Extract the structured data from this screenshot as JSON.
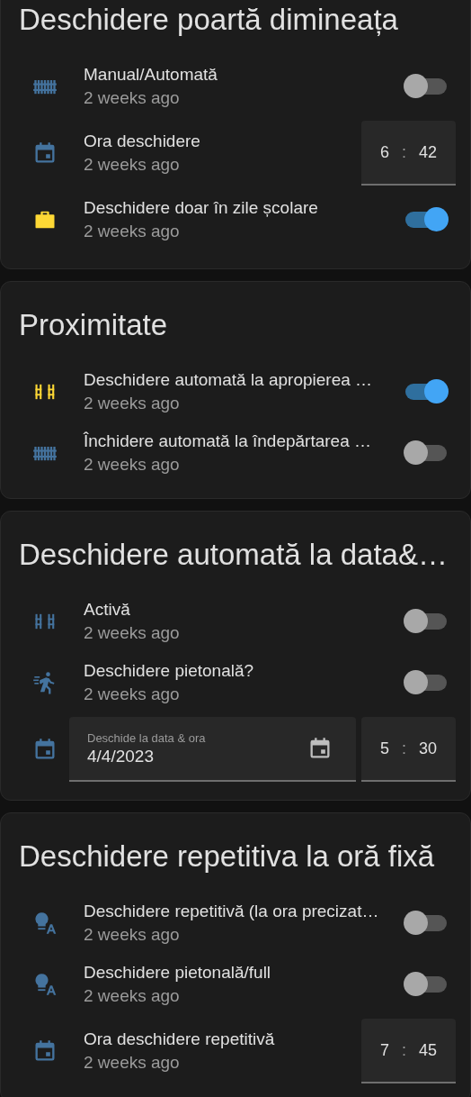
{
  "cards": [
    {
      "title": "Deschidere poartă dimineața",
      "rows": [
        {
          "kind": "toggle",
          "icon": {
            "kind": "fence"
          },
          "name": "Manual/Automată",
          "secondary": "2 weeks ago",
          "on": false
        },
        {
          "kind": "time",
          "icon": {
            "kind": "calendar"
          },
          "name": "Ora deschidere",
          "secondary": "2 weeks ago",
          "hour": "6",
          "separator": ":",
          "minute": "42"
        },
        {
          "kind": "toggle",
          "icon": {
            "kind": "briefcase"
          },
          "name": "Deschidere doar în zile școlare",
          "secondary": "2 weeks ago",
          "on": true
        }
      ]
    },
    {
      "title": "Proximitate",
      "rows": [
        {
          "kind": "toggle",
          "icon": {
            "kind": "gate"
          },
          "name": "Deschidere automată la apropierea …",
          "secondary": "2 weeks ago",
          "on": true
        },
        {
          "kind": "toggle",
          "icon": {
            "kind": "fence"
          },
          "name": "Închidere automată la îndepărtarea …",
          "secondary": "2 weeks ago",
          "on": false
        }
      ]
    },
    {
      "title": "Deschidere automată la data&…",
      "rows": [
        {
          "kind": "toggle",
          "icon": {
            "kind": "gate"
          },
          "name": "Activă",
          "secondary": "2 weeks ago",
          "on": false
        },
        {
          "kind": "toggle",
          "icon": {
            "kind": "walk"
          },
          "name": "Deschidere pietonală?",
          "secondary": "2 weeks ago",
          "on": false
        },
        {
          "kind": "datetime",
          "icon": {
            "kind": "calendar"
          },
          "label": "Deschide la data & ora",
          "date": "4/4/2023",
          "hour": "5",
          "separator": ":",
          "minute": "30"
        }
      ]
    },
    {
      "title": "Deschidere repetitiva la oră fixă",
      "rows": [
        {
          "kind": "toggle",
          "icon": {
            "kind": "bulb"
          },
          "name": "Deschidere repetitivă (la ora precizat…",
          "secondary": "2 weeks ago",
          "on": false
        },
        {
          "kind": "toggle",
          "icon": {
            "kind": "bulb"
          },
          "name": "Deschidere pietonală/full",
          "secondary": "2 weeks ago",
          "on": false
        },
        {
          "kind": "time",
          "icon": {
            "kind": "calendar"
          },
          "name": "Ora deschidere repetitivă",
          "secondary": "2 weeks ago",
          "hour": "7",
          "separator": ":",
          "minute": "45"
        }
      ]
    }
  ]
}
